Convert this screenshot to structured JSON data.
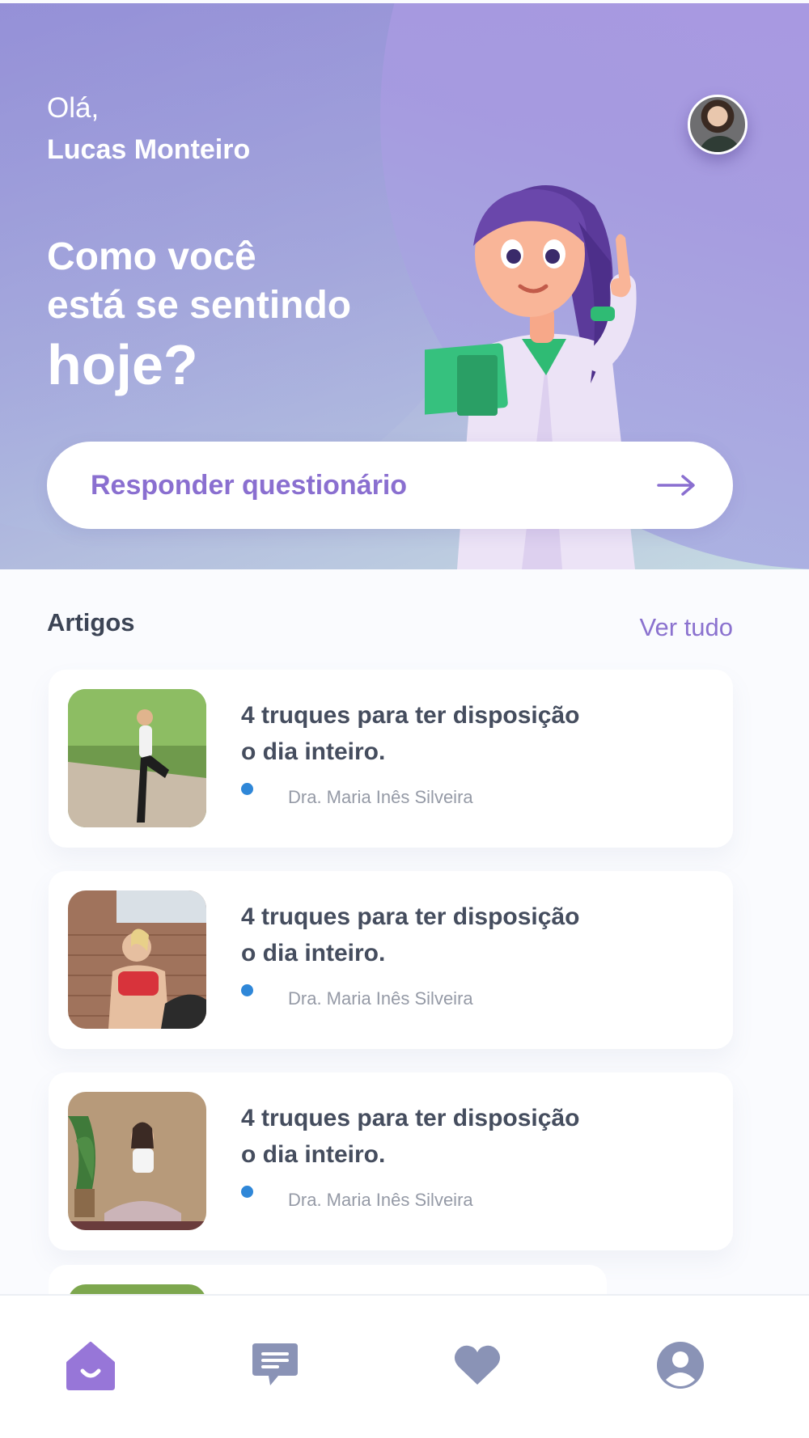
{
  "header": {
    "greeting": "Olá,",
    "user_name": "Lucas Monteiro",
    "headline_line1": "Como você",
    "headline_line2": "está se sentindo",
    "headline_line3": "hoje?",
    "cta_label": "Responder questionário"
  },
  "articles": {
    "section_title": "Artigos",
    "see_all": "Ver tudo",
    "items": [
      {
        "title": "4 truques para ter disposição o dia inteiro.",
        "author": "Dra. Maria Inês Silveira",
        "image": "woman-stretching-outdoors"
      },
      {
        "title": "4 truques para ter disposição o dia inteiro.",
        "author": "Dra. Maria Inês Silveira",
        "image": "woman-leaning-on-brick-wall"
      },
      {
        "title": "4 truques para ter disposição o dia inteiro.",
        "author": "Dra. Maria Inês Silveira",
        "image": "woman-meditating"
      }
    ]
  },
  "nav": {
    "items": [
      {
        "icon": "home-icon",
        "active": true
      },
      {
        "icon": "chat-icon",
        "active": false
      },
      {
        "icon": "heart-icon",
        "active": false
      },
      {
        "icon": "profile-icon",
        "active": false
      }
    ]
  },
  "colors": {
    "accent": "#8a6fd0",
    "nav_inactive": "#8a93b6",
    "nav_active": "#9776d8",
    "author_dot": "#2f87d8"
  }
}
